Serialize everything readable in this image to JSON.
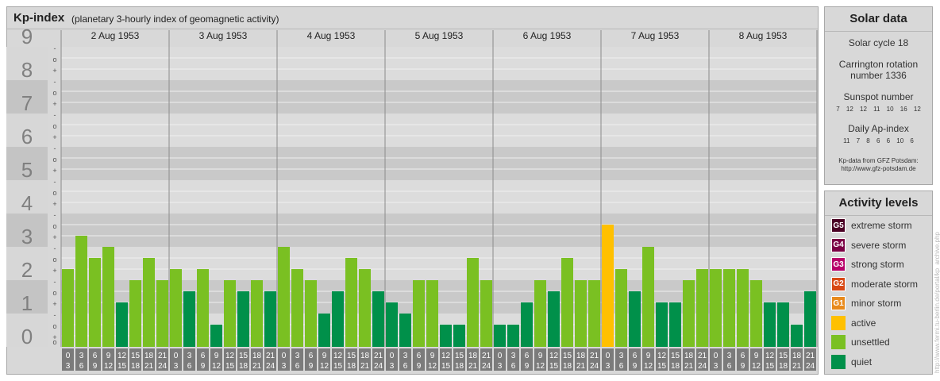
{
  "header": {
    "title": "Kp-index",
    "subtitle": "(planetary 3-hourly index of geomagnetic activity)"
  },
  "solar": {
    "title": "Solar data",
    "cycle": "Solar cycle 18",
    "carrington_line1": "Carrington rotation",
    "carrington_line2": "number 1336",
    "sunspot_title": "Sunspot number",
    "sunspot_values": "7 12 12 11 10 16 12",
    "ap_title": "Daily Ap-index",
    "ap_values": "11 7 8 6 6 10 6",
    "credit_line1": "Kp-data from GFZ Potsdam:",
    "credit_line2": "http://www.gfz-potsdam.de"
  },
  "activity": {
    "title": "Activity levels",
    "levels": [
      {
        "code": "G5",
        "label": "extreme storm",
        "color": "#4a0024"
      },
      {
        "code": "G4",
        "label": "severe storm",
        "color": "#7a0044"
      },
      {
        "code": "G3",
        "label": "strong storm",
        "color": "#b8006a"
      },
      {
        "code": "G2",
        "label": "moderate storm",
        "color": "#d84814"
      },
      {
        "code": "G1",
        "label": "minor storm",
        "color": "#e88a1c"
      },
      {
        "code": "",
        "label": "active",
        "color": "#ffc000"
      },
      {
        "code": "",
        "label": "unsettled",
        "color": "#7ac022"
      },
      {
        "code": "",
        "label": "quiet",
        "color": "#00904a"
      }
    ]
  },
  "watermark": "http://www.fermi.tu-berlin.de/portal/kp_archive.php",
  "chart_data": {
    "type": "bar",
    "ylim": [
      0,
      9
    ],
    "y_ticks": [
      "0",
      "1",
      "2",
      "3",
      "4",
      "5",
      "6",
      "7",
      "8",
      "9"
    ],
    "sub_ticks": [
      "+",
      "o",
      "-"
    ],
    "days": [
      "2 Aug 1953",
      "3 Aug 1953",
      "4 Aug 1953",
      "5 Aug 1953",
      "6 Aug 1953",
      "7 Aug 1953",
      "8 Aug 1953"
    ],
    "hour_start": [
      "0",
      "3",
      "6",
      "9",
      "12",
      "15",
      "18",
      "21"
    ],
    "hour_end": [
      "3",
      "6",
      "9",
      "12",
      "15",
      "18",
      "21",
      "24"
    ],
    "values": [
      2.333,
      3.333,
      2.667,
      3.0,
      1.333,
      2.0,
      2.667,
      2.0,
      2.333,
      1.667,
      2.333,
      0.667,
      2.0,
      1.667,
      2.0,
      1.667,
      3.0,
      2.333,
      2.0,
      1.0,
      1.667,
      2.667,
      2.333,
      1.667,
      1.333,
      1.0,
      2.0,
      2.0,
      0.667,
      0.667,
      2.667,
      2.0,
      0.667,
      0.667,
      1.333,
      2.0,
      1.667,
      2.667,
      2.0,
      2.0,
      3.667,
      2.333,
      1.667,
      3.0,
      1.333,
      1.333,
      2.0,
      2.333,
      2.333,
      2.333,
      2.333,
      2.0,
      1.333,
      1.333,
      0.667,
      1.667
    ],
    "level_colors": {
      "quiet": "#00904a",
      "unsettled": "#7ac022",
      "active": "#ffc000",
      "storm": "#e88a1c"
    }
  }
}
